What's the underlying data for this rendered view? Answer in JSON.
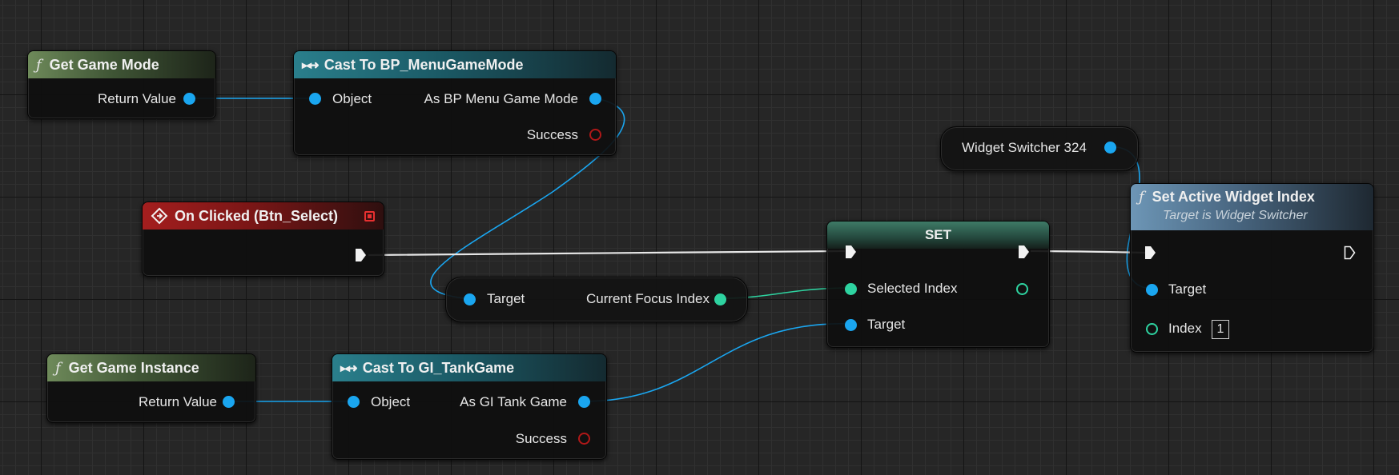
{
  "colors": {
    "object_wire": "#1aa6f0",
    "int_wire": "#2ed3a0",
    "exec_wire": "#e6e6e6",
    "event_header": "#a41e1e",
    "function_header": "#6e8a5a",
    "cast_header": "#2a7f8c"
  },
  "nodes": {
    "get_game_mode": {
      "title": "Get Game Mode",
      "out": "Return Value",
      "icon": "function-icon"
    },
    "cast_menu": {
      "title": "Cast To BP_MenuGameMode",
      "in": "Object",
      "out": "As BP Menu Game Mode",
      "success": "Success",
      "icon": "cast-icon"
    },
    "widget_switcher": {
      "label": "Widget Switcher 324"
    },
    "set_active": {
      "title": "Set Active Widget Index",
      "subtitle": "Target is Widget Switcher",
      "target": "Target",
      "index_label": "Index",
      "index_value": "1",
      "icon": "function-icon"
    },
    "on_clicked": {
      "title": "On Clicked (Btn_Select)",
      "icon": "event-icon"
    },
    "set": {
      "title": "SET",
      "selected": "Selected Index",
      "target": "Target"
    },
    "focus_getter": {
      "target": "Target",
      "out": "Current Focus Index"
    },
    "get_game_instance": {
      "title": "Get Game Instance",
      "out": "Return Value",
      "icon": "function-icon"
    },
    "cast_tank": {
      "title": "Cast To GI_TankGame",
      "in": "Object",
      "out": "As GI Tank Game",
      "success": "Success",
      "icon": "cast-icon"
    }
  }
}
